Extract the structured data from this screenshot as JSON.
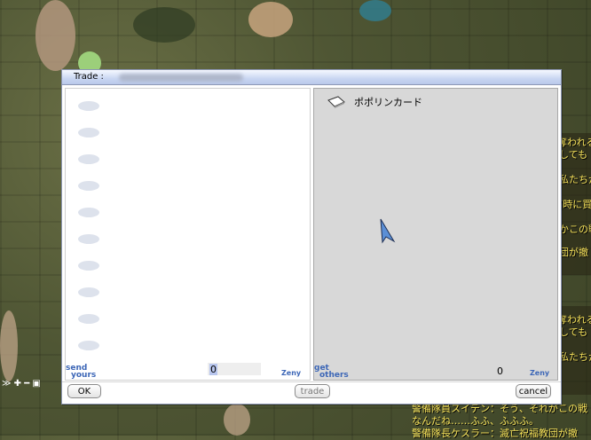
{
  "trade": {
    "title": "Trade :",
    "partner_item": {
      "name": "ポポリンカード",
      "icon": "card-icon"
    },
    "left_panel": {
      "label_top": "send",
      "label_bottom": "yours",
      "zeny_value": "0",
      "zeny_unit": "Zeny",
      "slots": 10
    },
    "right_panel": {
      "label_top": "get",
      "label_bottom": "others",
      "zeny_value": "0",
      "zeny_unit": "Zeny"
    },
    "buttons": {
      "ok": "OK",
      "trade": "trade",
      "cancel": "cancel"
    }
  },
  "chat": {
    "lines": [
      "奪われる",
      "しても",
      "私たちか",
      "(時に買",
      "かこの戦",
      "団が撤",
      "奪われる",
      "しても",
      "私たちか",
      "警備隊員スイデン：そう、それがこの戦",
      "なんだね……ふふ、ふふふ。",
      "警備隊長ケスラー：滅亡祝福教団が撤"
    ]
  },
  "hud": {
    "icons": "≫ ✚ ━ ▣"
  },
  "colors": {
    "label_blue": "#3d67b7",
    "titlebar": "#c9d6f2",
    "chat_yellow": "#f5e15a"
  }
}
